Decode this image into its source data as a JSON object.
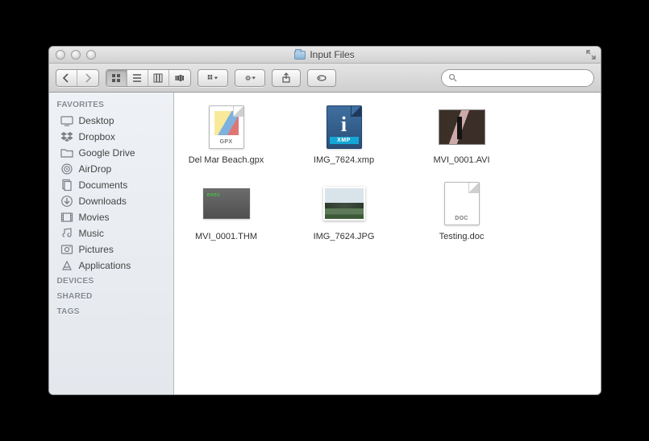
{
  "window": {
    "title": "Input Files"
  },
  "toolbar": {
    "search_placeholder": ""
  },
  "sidebar": {
    "sections": [
      {
        "heading": "FAVORITES",
        "items": [
          {
            "label": "Desktop",
            "icon": "desktop"
          },
          {
            "label": "Dropbox",
            "icon": "dropbox"
          },
          {
            "label": "Google Drive",
            "icon": "folder"
          },
          {
            "label": "AirDrop",
            "icon": "airdrop"
          },
          {
            "label": "Documents",
            "icon": "documents"
          },
          {
            "label": "Downloads",
            "icon": "downloads"
          },
          {
            "label": "Movies",
            "icon": "movies"
          },
          {
            "label": "Music",
            "icon": "music"
          },
          {
            "label": "Pictures",
            "icon": "pictures"
          },
          {
            "label": "Applications",
            "icon": "applications"
          }
        ]
      },
      {
        "heading": "DEVICES",
        "items": []
      },
      {
        "heading": "SHARED",
        "items": []
      },
      {
        "heading": "TAGS",
        "items": []
      }
    ]
  },
  "files": [
    {
      "name": "Del Mar Beach.gpx",
      "kind": "gpx",
      "badge": "GPX"
    },
    {
      "name": "IMG_7624.xmp",
      "kind": "xmp",
      "badge": "XMP"
    },
    {
      "name": "MVI_0001.AVI",
      "kind": "avi"
    },
    {
      "name": "MVI_0001.THM",
      "kind": "thm"
    },
    {
      "name": "IMG_7624.JPG",
      "kind": "jpg"
    },
    {
      "name": "Testing.doc",
      "kind": "doc",
      "badge": "DOC"
    }
  ]
}
